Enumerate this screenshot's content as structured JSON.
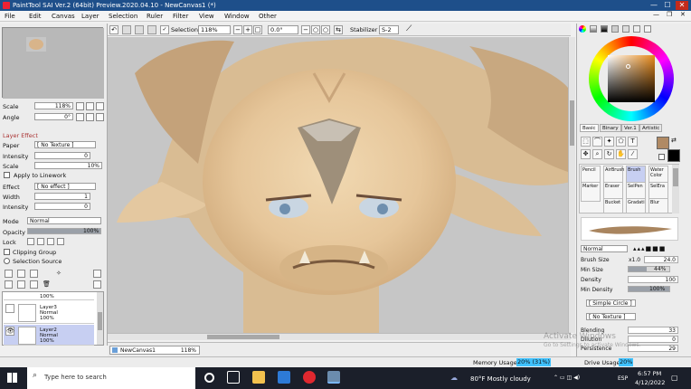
{
  "window": {
    "title": "PaintTool SAI Ver.2 (64bit) Preview.2020.04.10 - NewCanvas1 (*)",
    "minimize": "—",
    "maximize": "☐",
    "close": "✕",
    "inner_minimize": "—",
    "inner_restore": "❐",
    "inner_close": "✕"
  },
  "menu": [
    "File",
    "Edit",
    "Canvas",
    "Layer",
    "Selection",
    "Ruler",
    "Filter",
    "View",
    "Window",
    "Other"
  ],
  "toolbar": {
    "selection_label": "Selection",
    "zoom": "118%",
    "rotation": "0.0°",
    "stabilizer_label": "Stabilizer",
    "stabilizer_value": "S-2"
  },
  "navigator": {
    "scale_label": "Scale",
    "scale_value": "118%",
    "angle_label": "Angle",
    "angle_value": "0°"
  },
  "layer_effect": {
    "header": "Layer Effect",
    "paper_label": "Paper",
    "paper_value": "[ No Texture ]",
    "intensity_label": "Intensity",
    "intensity_value": "0",
    "scale_label": "Scale",
    "scale_value": "10%",
    "apply_linework": "Apply to Linework",
    "effect_label": "Effect",
    "effect_value": "[ No effect ]",
    "width_label": "Width",
    "width_value": "1",
    "intensity2_label": "Intensity",
    "intensity2_value": "0"
  },
  "layer_props": {
    "mode_label": "Mode",
    "mode_value": "Normal",
    "opacity_label": "Opacity",
    "opacity_value": "100%",
    "opacity_fraction": 1.0,
    "lock_label": "Lock",
    "clipping_group": "Clipping Group",
    "selection_source": "Selection Source"
  },
  "layers": [
    {
      "name": "",
      "mode": "",
      "opacity": "100%",
      "selected": false
    },
    {
      "name": "Layer3",
      "mode": "Normal",
      "opacity": "100%",
      "selected": false
    },
    {
      "name": "Layer2",
      "mode": "Normal",
      "opacity": "100%",
      "selected": true
    }
  ],
  "document_tab": {
    "name": "NewCanvas1",
    "zoom": "118%"
  },
  "status": {
    "memory_label": "Memory Usage",
    "memory_value": "20% (31%)",
    "drive_label": "Drive Usage",
    "drive_value": "20%"
  },
  "color_tabs": [
    "Basic",
    "Binary",
    "Ver.1",
    "Artistic"
  ],
  "brushes": [
    {
      "name": "Pencil",
      "selected": false
    },
    {
      "name": "AirBrush",
      "selected": false
    },
    {
      "name": "Brush",
      "selected": true
    },
    {
      "name": "Water Color",
      "selected": false
    },
    {
      "name": "Marker",
      "selected": false
    },
    {
      "name": "Eraser",
      "selected": false
    },
    {
      "name": "SelPen",
      "selected": false
    },
    {
      "name": "SelEra",
      "selected": false
    },
    {
      "name": "Bucket",
      "selected": false
    },
    {
      "name": "Gradati",
      "selected": false
    },
    {
      "name": "Blur",
      "selected": false
    }
  ],
  "brush_props": {
    "mode_value": "Normal",
    "size_label": "Brush Size",
    "size_mult": "x1.0",
    "size_value": "24.0",
    "min_size_label": "Min Size",
    "min_size_value": "44%",
    "min_size_fraction": 0.44,
    "density_label": "Density",
    "density_value": "100",
    "min_density_label": "Min Density",
    "min_density_value": "100%",
    "shape_value": "[ Simple Circle ]",
    "texture_value": "[ No Texture ]",
    "blending_label": "Blending",
    "blending_value": "33",
    "dilution_label": "Dilution",
    "dilution_value": "0",
    "persistence_label": "Persistence",
    "persistence_value": "29"
  },
  "colors": {
    "titlebar": "#1e4f8a",
    "primary_swatch": "#b08a64",
    "secondary_swatch": "#000000",
    "selection": "#c7cff2"
  },
  "watermark": {
    "line1": "Activate Windows",
    "line2": "Go to Settings to activate Windows."
  },
  "taskbar": {
    "search_placeholder": "Type here to search",
    "weather": "80°F  Mostly cloudy",
    "language": "ESP",
    "time": "6:57 PM",
    "date": "4/12/2022"
  }
}
